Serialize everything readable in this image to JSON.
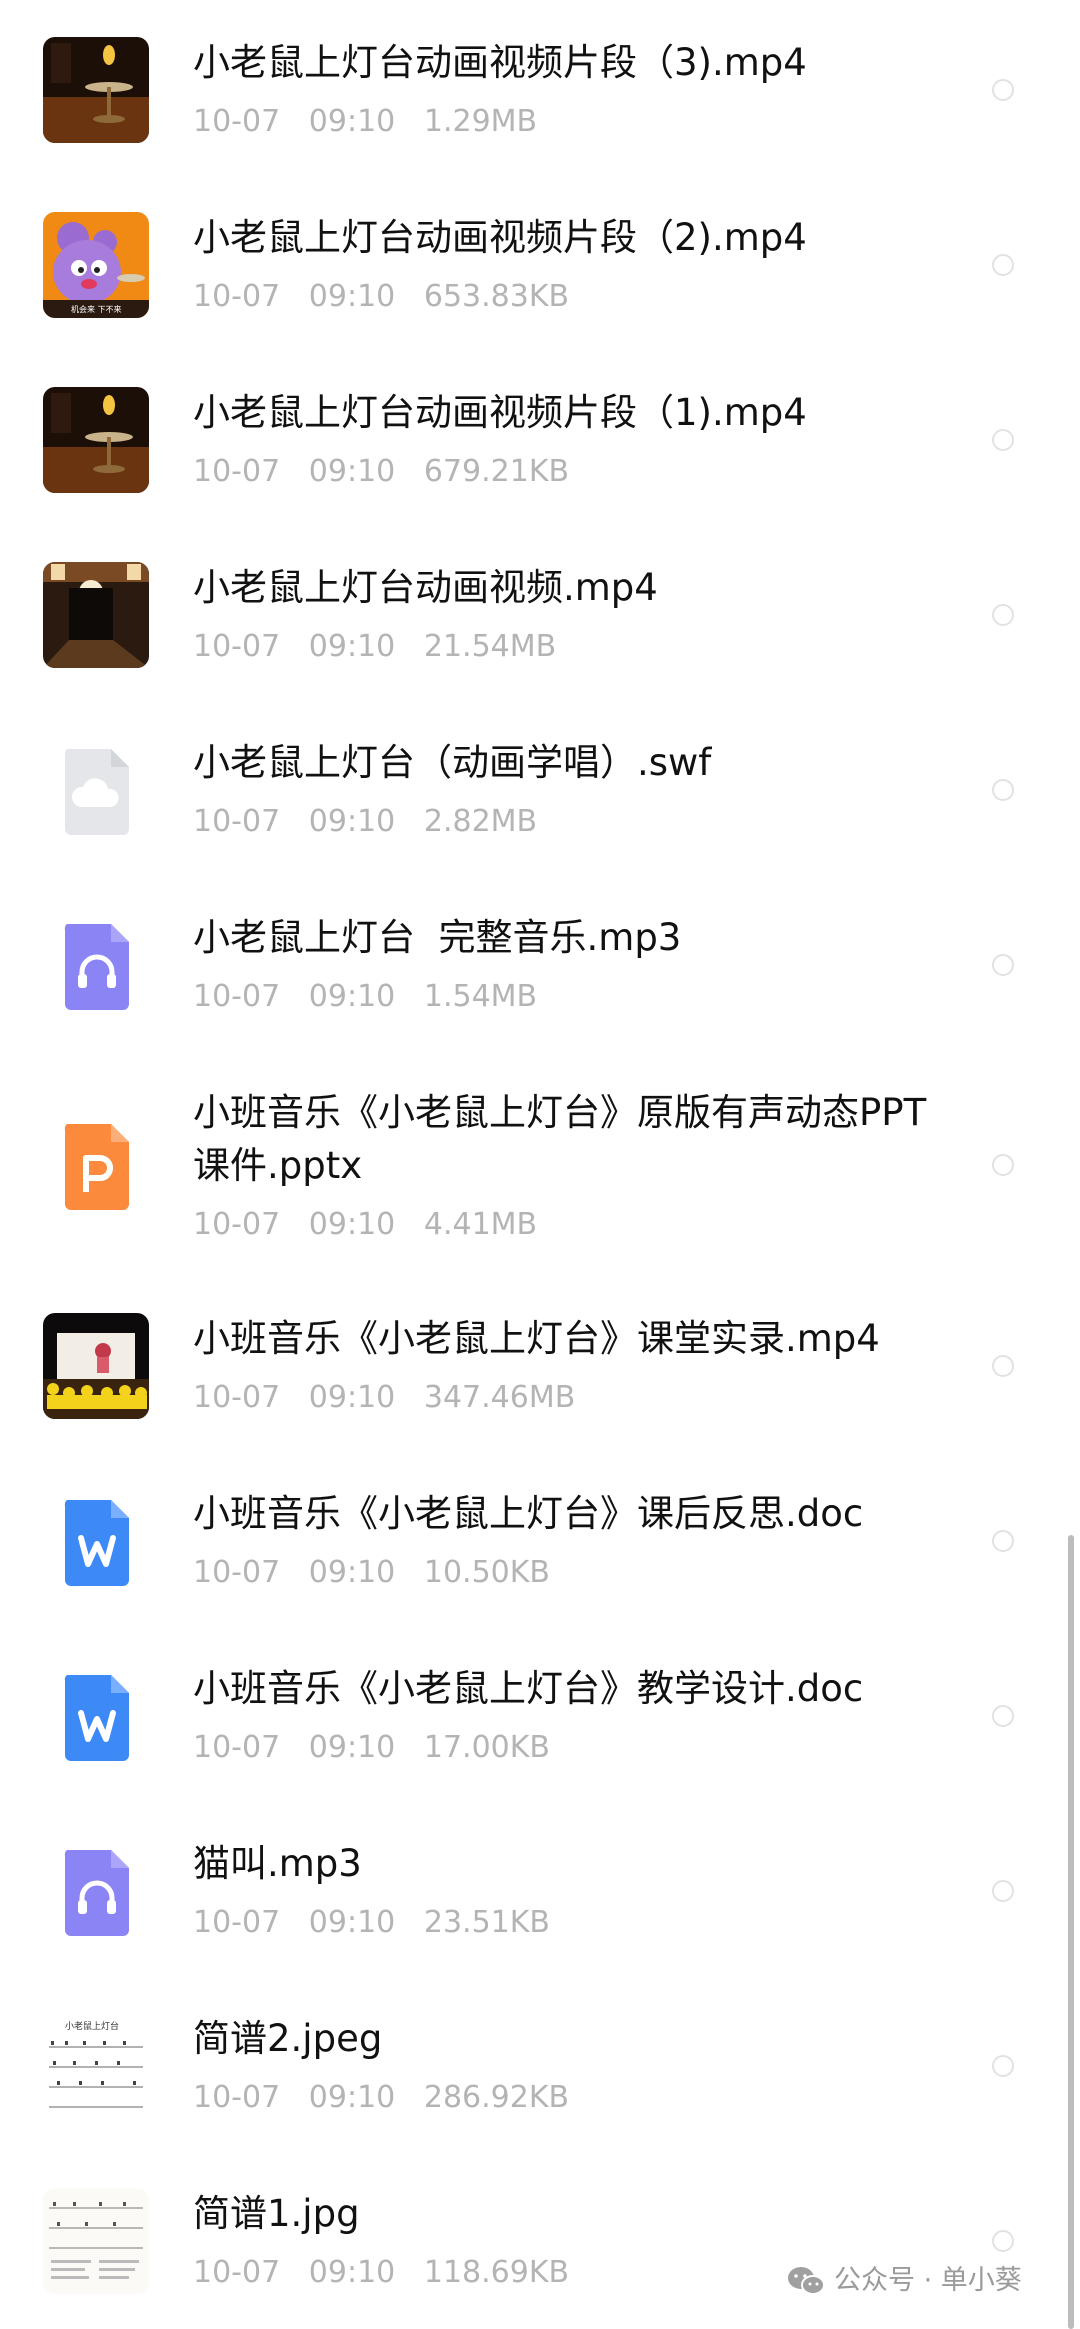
{
  "files": [
    {
      "name": "小老鼠上灯台动画视频片段（3).mp4",
      "date": "10-07",
      "time": "09:10",
      "size": "1.29MB",
      "icon": "video-thumbnail-lamp"
    },
    {
      "name": "小老鼠上灯台动画视频片段（2).mp4",
      "date": "10-07",
      "time": "09:10",
      "size": "653.83KB",
      "icon": "video-thumbnail-mouse"
    },
    {
      "name": "小老鼠上灯台动画视频片段（1).mp4",
      "date": "10-07",
      "time": "09:10",
      "size": "679.21KB",
      "icon": "video-thumbnail-lamp"
    },
    {
      "name": "小老鼠上灯台动画视频.mp4",
      "date": "10-07",
      "time": "09:10",
      "size": "21.54MB",
      "icon": "video-thumbnail-room"
    },
    {
      "name": "小老鼠上灯台（动画学唱）.swf",
      "date": "10-07",
      "time": "09:10",
      "size": "2.82MB",
      "icon": "cloud-file-icon"
    },
    {
      "name": "小老鼠上灯台  完整音乐.mp3",
      "date": "10-07",
      "time": "09:10",
      "size": "1.54MB",
      "icon": "audio-file-icon"
    },
    {
      "name": "小班音乐《小老鼠上灯台》原版有声动态PPT课件.pptx",
      "date": "10-07",
      "time": "09:10",
      "size": "4.41MB",
      "icon": "ppt-file-icon"
    },
    {
      "name": "小班音乐《小老鼠上灯台》课堂实录.mp4",
      "date": "10-07",
      "time": "09:10",
      "size": "347.46MB",
      "icon": "video-thumbnail-stage"
    },
    {
      "name": "小班音乐《小老鼠上灯台》课后反思.doc",
      "date": "10-07",
      "time": "09:10",
      "size": "10.50KB",
      "icon": "word-file-icon"
    },
    {
      "name": "小班音乐《小老鼠上灯台》教学设计.doc",
      "date": "10-07",
      "time": "09:10",
      "size": "17.00KB",
      "icon": "word-file-icon"
    },
    {
      "name": "猫叫.mp3",
      "date": "10-07",
      "time": "09:10",
      "size": "23.51KB",
      "icon": "audio-file-icon"
    },
    {
      "name": "简谱2.jpeg",
      "date": "10-07",
      "time": "09:10",
      "size": "286.92KB",
      "icon": "image-thumbnail-score"
    },
    {
      "name": "简谱1.jpg",
      "date": "10-07",
      "time": "09:10",
      "size": "118.69KB",
      "icon": "image-thumbnail-score"
    }
  ],
  "watermark": {
    "text": "公众号 · 单小葵"
  },
  "colors": {
    "title": "#111111",
    "meta": "#b4b4b4",
    "word": "#3d8af7",
    "ppt": "#fb8a3c",
    "audio": "#8a84f4",
    "cloud": "#e4e6ea"
  },
  "thumb_labels": {
    "mouse_caption": "机会来  下不来",
    "score_title": "小老鼠上灯台"
  }
}
